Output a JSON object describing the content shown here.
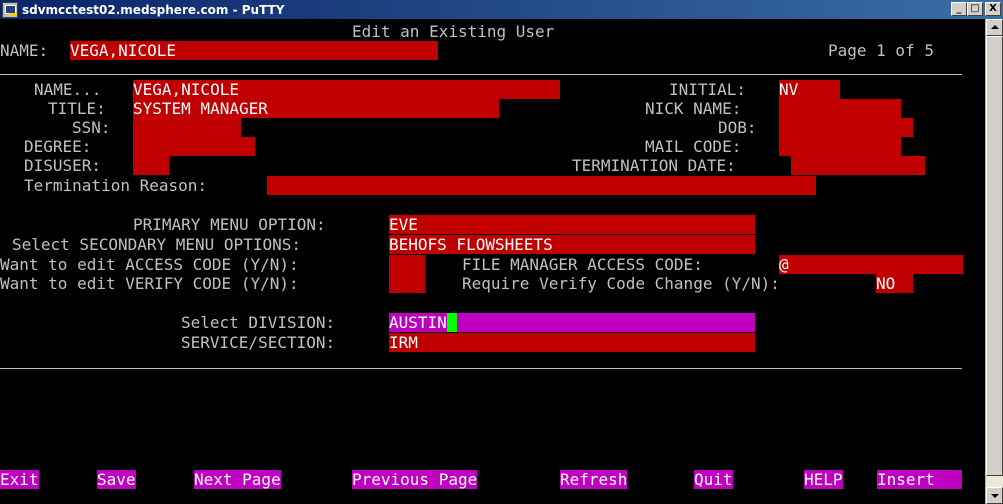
{
  "window": {
    "title": "sdvmcctest02.medsphere.com - PuTTY",
    "minimize": "_",
    "maximize": "□",
    "close": "X"
  },
  "header": {
    "screen_title": "Edit an Existing User",
    "name_label": "NAME:",
    "name_value": "VEGA,NICOLE",
    "page_text": "Page 1 of 5"
  },
  "fields": {
    "name_label": "NAME...",
    "name_value": "VEGA,NICOLE",
    "initial_label": "INITIAL:",
    "initial_value": "NV",
    "title_label": "TITLE:",
    "title_value": "SYSTEM MANAGER",
    "nick_label": "NICK NAME:",
    "nick_value": "",
    "ssn_label": "SSN:",
    "ssn_value": "",
    "dob_label": "DOB:",
    "dob_value": "",
    "degree_label": "DEGREE:",
    "degree_value": "",
    "mail_label": "MAIL CODE:",
    "mail_value": "",
    "disuser_label": "DISUSER:",
    "disuser_value": "",
    "termdate_label": "TERMINATION DATE:",
    "termdate_value": "",
    "termreason_label": "Termination Reason:",
    "termreason_value": ""
  },
  "menu": {
    "primary_label": "PRIMARY MENU OPTION:",
    "primary_value": "EVE",
    "secondary_label": "Select SECONDARY MENU OPTIONS:",
    "secondary_value": "BEHOFS FLOWSHEETS",
    "access_label": "Want to edit ACCESS CODE (Y/N):",
    "access_value": "",
    "fm_label": "FILE MANAGER ACCESS CODE:",
    "fm_value": "@",
    "verify_label": "Want to edit VERIFY CODE (Y/N):",
    "verify_value": "",
    "reqverify_label": "Require Verify Code Change (Y/N):",
    "reqverify_value": "NO"
  },
  "division": {
    "division_label": "Select DIVISION:",
    "division_value": "AUSTIN",
    "service_label": "SERVICE/SECTION:",
    "service_value": "IRM"
  },
  "commands": {
    "exit": "Exit",
    "save": "Save",
    "next_page": "Next Page",
    "previous_page": "Previous Page",
    "refresh": "Refresh",
    "quit": "Quit",
    "help": "HELP",
    "insert": "Insert"
  },
  "colors": {
    "field_bg": "#c00000",
    "active_field_bg": "#c000c0",
    "cursor": "#00ff00",
    "label_text": "#c0c0c0"
  }
}
